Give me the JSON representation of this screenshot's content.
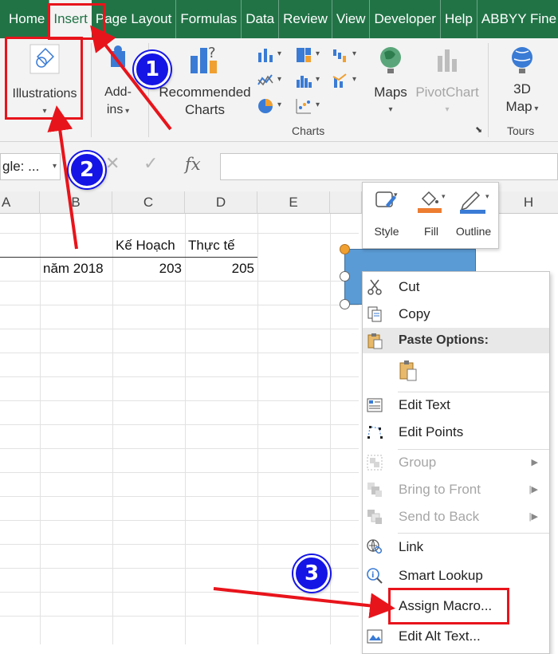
{
  "ribbon_tabs": [
    "Home",
    "Insert",
    "Page Layout",
    "Formulas",
    "Data",
    "Review",
    "View",
    "Developer",
    "Help",
    "ABBYY Fine"
  ],
  "ribbon": {
    "illustrations": "Illustrations",
    "addins_line1": "Add-",
    "addins_line2": "ins",
    "recommended_line1": "Recommended",
    "recommended_line2": "Charts",
    "maps": "Maps",
    "pivotchart": "PivotChart",
    "map3d_line1": "3D",
    "map3d_line2": "Map",
    "charts_group": "Charts",
    "tours_group": "Tours"
  },
  "formula_bar": {
    "name_box": "gle: ...",
    "fx": "fx"
  },
  "grid": {
    "columns": [
      "A",
      "B",
      "C",
      "D",
      "E",
      "H"
    ],
    "header_row": [
      "Kế Hoạch",
      "Thực tế"
    ],
    "row": {
      "label": "năm 2018",
      "plan": "203",
      "actual": "205"
    }
  },
  "mini_toolbar": {
    "style": "Style",
    "fill": "Fill",
    "outline": "Outline"
  },
  "context_menu": {
    "cut": "Cut",
    "copy": "Copy",
    "paste_options": "Paste Options:",
    "edit_text": "Edit Text",
    "edit_points": "Edit Points",
    "group": "Group",
    "bring_to_front": "Bring to Front",
    "send_to_back": "Send to Back",
    "link": "Link",
    "smart_lookup": "Smart Lookup",
    "assign_macro": "Assign Macro...",
    "edit_alt_text": "Edit Alt Text..."
  },
  "annotations": {
    "step1": "1",
    "step2": "2",
    "step3": "3"
  },
  "colors": {
    "excel_green": "#217346",
    "annotation_red": "#e8141b",
    "badge_blue": "#1515e6",
    "shape_blue": "#5b9bd5"
  }
}
